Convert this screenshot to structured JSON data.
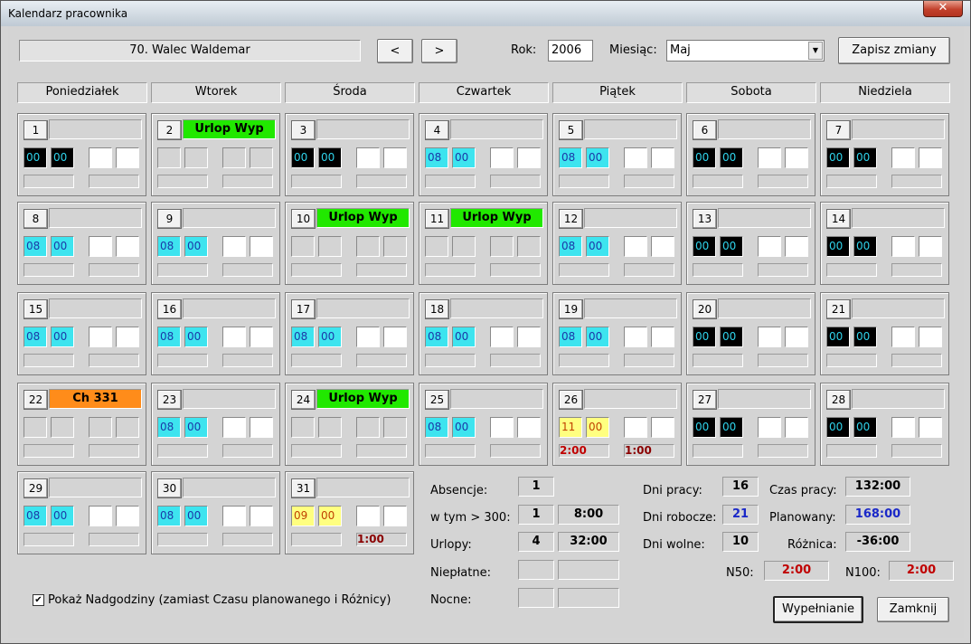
{
  "window": {
    "title": "Kalendarz pracownika",
    "close": "✕"
  },
  "header": {
    "employee": "70. Walec Waldemar",
    "prev": "<",
    "next": ">",
    "year_label": "Rok:",
    "year": "2006",
    "month_label": "Miesiąc:",
    "month": "Maj",
    "save": "Zapisz zmiany"
  },
  "weekdays": [
    "Poniedziałek",
    "Wtorek",
    "Środa",
    "Czwartek",
    "Piątek",
    "Sobota",
    "Niedziela"
  ],
  "days": [
    {
      "n": "1",
      "tag": "",
      "h": "00",
      "m": "00",
      "style": "b"
    },
    {
      "n": "2",
      "tag": "Urlop Wyp",
      "tagColor": "#21e800",
      "h": "",
      "m": "",
      "style": "e"
    },
    {
      "n": "3",
      "tag": "",
      "h": "00",
      "m": "00",
      "style": "b"
    },
    {
      "n": "4",
      "tag": "",
      "h": "08",
      "m": "00",
      "style": "c"
    },
    {
      "n": "5",
      "tag": "",
      "h": "08",
      "m": "00",
      "style": "c"
    },
    {
      "n": "6",
      "tag": "",
      "h": "00",
      "m": "00",
      "style": "b"
    },
    {
      "n": "7",
      "tag": "",
      "h": "00",
      "m": "00",
      "style": "b"
    },
    {
      "n": "8",
      "tag": "",
      "h": "08",
      "m": "00",
      "style": "c"
    },
    {
      "n": "9",
      "tag": "",
      "h": "08",
      "m": "00",
      "style": "c"
    },
    {
      "n": "10",
      "tag": "Urlop Wyp",
      "tagColor": "#21e800",
      "h": "",
      "m": "",
      "style": "e"
    },
    {
      "n": "11",
      "tag": "Urlop Wyp",
      "tagColor": "#21e800",
      "h": "",
      "m": "",
      "style": "e"
    },
    {
      "n": "12",
      "tag": "",
      "h": "08",
      "m": "00",
      "style": "c"
    },
    {
      "n": "13",
      "tag": "",
      "h": "00",
      "m": "00",
      "style": "b"
    },
    {
      "n": "14",
      "tag": "",
      "h": "00",
      "m": "00",
      "style": "b"
    },
    {
      "n": "15",
      "tag": "",
      "h": "08",
      "m": "00",
      "style": "c"
    },
    {
      "n": "16",
      "tag": "",
      "h": "08",
      "m": "00",
      "style": "c"
    },
    {
      "n": "17",
      "tag": "",
      "h": "08",
      "m": "00",
      "style": "c"
    },
    {
      "n": "18",
      "tag": "",
      "h": "08",
      "m": "00",
      "style": "c"
    },
    {
      "n": "19",
      "tag": "",
      "h": "08",
      "m": "00",
      "style": "c"
    },
    {
      "n": "20",
      "tag": "",
      "h": "00",
      "m": "00",
      "style": "b"
    },
    {
      "n": "21",
      "tag": "",
      "h": "00",
      "m": "00",
      "style": "b"
    },
    {
      "n": "22",
      "tag": "Ch 331",
      "tagColor": "#ff8c1a",
      "h": "",
      "m": "",
      "style": "e"
    },
    {
      "n": "23",
      "tag": "",
      "h": "08",
      "m": "00",
      "style": "c"
    },
    {
      "n": "24",
      "tag": "Urlop Wyp",
      "tagColor": "#21e800",
      "h": "",
      "m": "",
      "style": "e"
    },
    {
      "n": "25",
      "tag": "",
      "h": "08",
      "m": "00",
      "style": "c"
    },
    {
      "n": "26",
      "tag": "",
      "h": "11",
      "m": "00",
      "style": "y",
      "ot1": "2:00",
      "ot2": "1:00"
    },
    {
      "n": "27",
      "tag": "",
      "h": "00",
      "m": "00",
      "style": "b"
    },
    {
      "n": "28",
      "tag": "",
      "h": "00",
      "m": "00",
      "style": "b"
    },
    {
      "n": "29",
      "tag": "",
      "h": "08",
      "m": "00",
      "style": "c"
    },
    {
      "n": "30",
      "tag": "",
      "h": "08",
      "m": "00",
      "style": "c"
    },
    {
      "n": "31",
      "tag": "",
      "h": "09",
      "m": "00",
      "style": "y",
      "ot2": "1:00"
    }
  ],
  "summary": {
    "absencje_label": "Absencje:",
    "absencje": "1",
    "wtym_label": "w tym > 300:",
    "wtym": "1",
    "wtym_time": "8:00",
    "urlopy_label": "Urlopy:",
    "urlopy": "4",
    "urlopy_time": "32:00",
    "nieplatne_label": "Niepłatne:",
    "nocne_label": "Nocne:",
    "dni_pracy_label": "Dni pracy:",
    "dni_pracy": "16",
    "dni_robocze_label": "Dni robocze:",
    "dni_robocze": "21",
    "dni_wolne_label": "Dni wolne:",
    "dni_wolne": "10",
    "czas_pracy_label": "Czas pracy:",
    "czas_pracy": "132:00",
    "planowany_label": "Planowany:",
    "planowany": "168:00",
    "roznica_label": "Różnica:",
    "roznica": "-36:00",
    "n50_label": "N50:",
    "n50": "2:00",
    "n100_label": "N100:",
    "n100": "2:00"
  },
  "footer": {
    "checkbox_label": "Pokaż Nadgodziny (zamiast Czasu planowanego i Różnicy)",
    "checked": "✔",
    "fill": "Wypełnianie",
    "close": "Zamknij"
  }
}
